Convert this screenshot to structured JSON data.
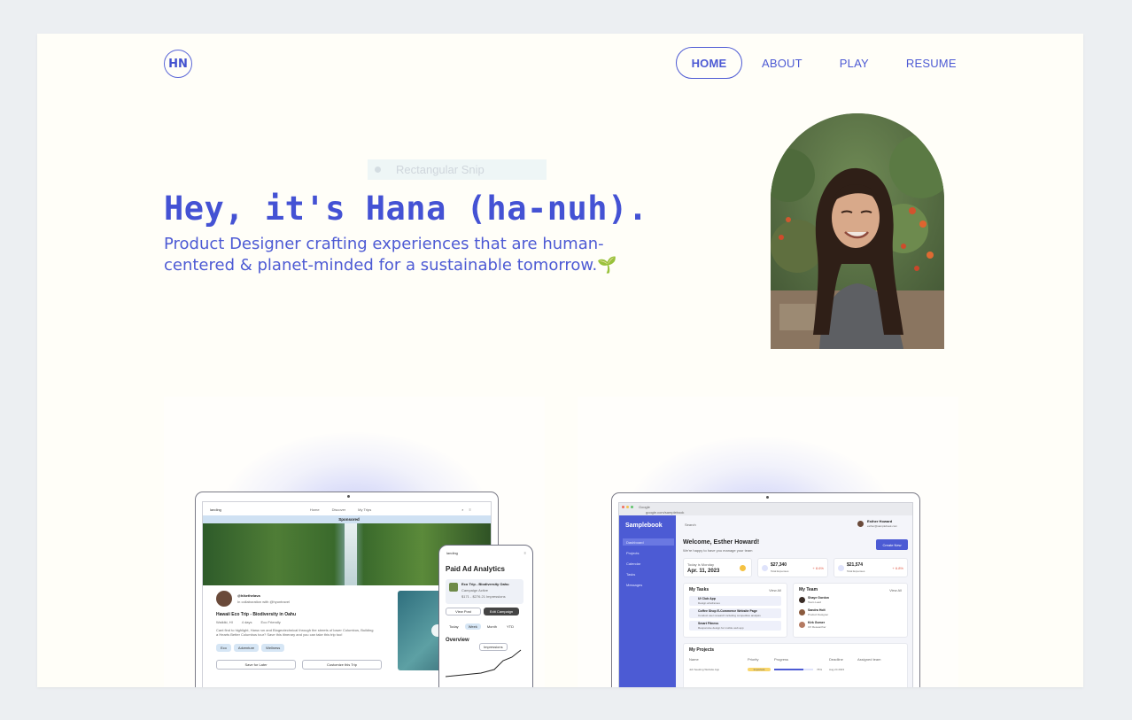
{
  "header": {
    "logo": "HN",
    "nav": [
      {
        "label": "HOME",
        "active": true
      },
      {
        "label": "ABOUT",
        "active": false
      },
      {
        "label": "PLAY",
        "active": false
      },
      {
        "label": "RESUME",
        "active": false
      }
    ]
  },
  "overlay": {
    "snip_label": "Rectangular Snip"
  },
  "hero": {
    "title": "Hey, it's Hana (ha-nuh).",
    "subtitle": "Product Designer crafting experiences that are human-centered & planet-minded for a sustainable tomorrow.",
    "subtitle_emoji": "🌱"
  },
  "projects": [
    {
      "laptop": {
        "brand": "landing",
        "nav": [
          "Home",
          "Discover",
          "My Trips"
        ],
        "banner": "Sponsored",
        "author": "@hikethelava",
        "author_note": "In collaboration with @hyuntravel",
        "post_title": "Hawaii Eco Trip - Biodiversity in Oahu",
        "post_meta": [
          "Waikiki, HI",
          "4 days",
          "Eco Friendly"
        ],
        "post_body": "Cant find to highlight, Hana run and Biogeotechnical through the streets of lower Columbus, Building a Hearts Better Columbus tour? Save this itinerary and you can take this trip too!",
        "tags": [
          "Eco",
          "Adventure",
          "Wellness"
        ],
        "buttons": [
          "Save for Later",
          "Customize this Trip"
        ]
      },
      "phone": {
        "brand": "landing",
        "title": "Paid Ad Analytics",
        "item_title": "Eco Trip - Biodiversity Oahu",
        "item_sub": "Campaign Active",
        "item_stats": "$171 - $276.21 Impressions",
        "buttons": [
          "View Post",
          "Edit Campaign"
        ],
        "ranges": [
          "Today",
          "Week",
          "Month",
          "YTD"
        ],
        "section": "Overview",
        "dropdown": "Impressions"
      }
    },
    {
      "laptop": {
        "browser_tab": "Google",
        "url": "google.com/samplebook",
        "brand": "Samplebook",
        "sidebar": [
          "Dashboard",
          "Projects",
          "Calendar",
          "Tasks",
          "Messages"
        ],
        "search": "Search",
        "user_name": "Esther Howard",
        "user_email": "esther@samplebook.com",
        "welcome": "Welcome, Esther Howard!",
        "welcome_sub": "We're happy to have you manage your team",
        "action_button": "Create New",
        "date_label": "Today is Monday",
        "date": "Apr. 11, 2023",
        "stats": [
          {
            "value": "$27,340",
            "label": "Total Expenses",
            "delta": "+ 8.6%"
          },
          {
            "value": "$21,574",
            "label": "Total Expenses",
            "delta": "+ 6.8%"
          }
        ],
        "tasks_title": "My Tasks",
        "view_all": "View All",
        "tasks": [
          {
            "title": "UI Club App",
            "sub": "Design wireframes"
          },
          {
            "title": "Coffee Shop E-Commerce Website Page",
            "sub": "Conduct user research including competitive analysis"
          },
          {
            "title": "Smart Fitness",
            "sub": "Responsive design for mobile web app"
          }
        ],
        "team_title": "My Team",
        "team": [
          {
            "name": "Shaye Gordon",
            "role": "Team Lead"
          },
          {
            "name": "Sandra Holt",
            "role": "Product Designer"
          },
          {
            "name": "Kirk Gomer",
            "role": "UX Researcher"
          }
        ],
        "projects_title": "My Projects",
        "project_columns": [
          "Name",
          "Priority",
          "Progress",
          "Deadline",
          "Assigned team"
        ],
        "project_row": {
          "name": "Job Seeking Website App",
          "priority": "Important",
          "progress": "76%",
          "deadline": "Aug 24 2023"
        }
      }
    }
  ],
  "colors": {
    "accent": "#4452d4",
    "page_bg": "#fffef8",
    "outer_bg": "#eceff2",
    "sidebar_blue": "#4c5bd4"
  }
}
